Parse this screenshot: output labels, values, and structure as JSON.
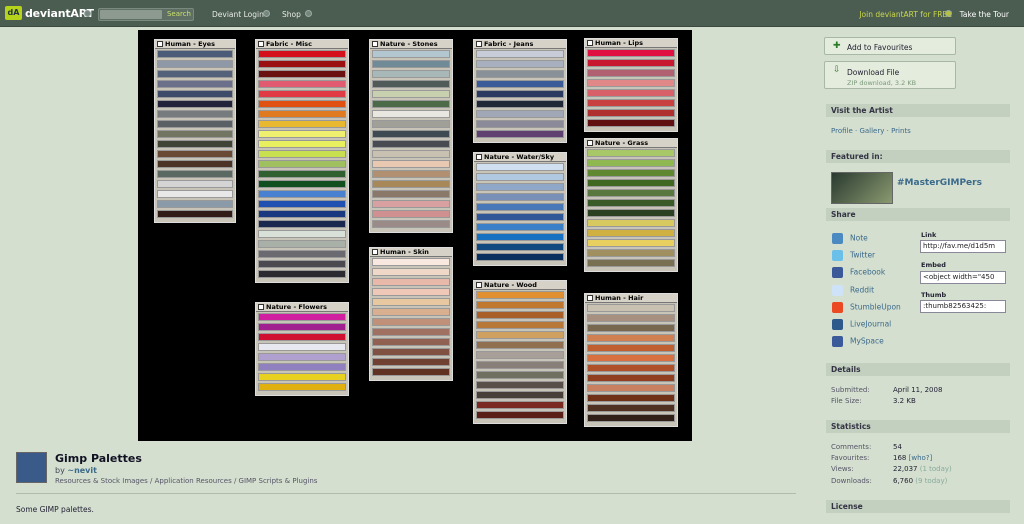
{
  "topbar": {
    "logo_text": "dA",
    "brand": "deviantART",
    "search_button": "Search",
    "login_label": "Deviant Login",
    "shop_label": "Shop",
    "join_label": "Join deviantART for FREE",
    "tour_label": "Take the Tour"
  },
  "palettes": [
    {
      "title": "Human - Eyes",
      "colors": [
        "#4b5b78",
        "#8e98a6",
        "#53617a",
        "#6b6f8a",
        "#3d4a6a",
        "#22233a",
        "#767b7e",
        "#5a6064",
        "#737563",
        "#3f4436",
        "#6a4a35",
        "#4b3325",
        "#5a6a62",
        "#d4d4d4",
        "#e8e8e8",
        "#8a9aa8",
        "#321c17"
      ]
    },
    {
      "title": "Fabric - Misc",
      "colors": [
        "#d3101c",
        "#9b1010",
        "#6a1010",
        "#e05a70",
        "#e03a45",
        "#e05010",
        "#e07a20",
        "#e8b830",
        "#f0f070",
        "#e8f060",
        "#c8e050",
        "#a0c060",
        "#306030",
        "#105020",
        "#4a80d0",
        "#2050b0",
        "#1a3880",
        "#1a2850",
        "#d8e0d8",
        "#a8b0a8",
        "#6a6a70",
        "#4a4a50",
        "#2a2a30"
      ]
    },
    {
      "title": "Nature - Stones",
      "colors": [
        "#b3c7d0",
        "#708a98",
        "#a8b8b8",
        "#505a58",
        "#c8d0b0",
        "#4a6a48",
        "#e8e8e0",
        "#a0a098",
        "#3e4a52",
        "#484c52",
        "#c8c0b0",
        "#e8c8b0",
        "#b09070",
        "#a88858",
        "#8a7868",
        "#d8a0a0",
        "#d09090",
        "#9a8a88"
      ]
    },
    {
      "title": "Fabric - Jeans",
      "colors": [
        "#c8ccd8",
        "#a8b0c0",
        "#889098",
        "#3a5a98",
        "#2a3a60",
        "#202838",
        "#a0a8b8",
        "#8a8a98",
        "#604070"
      ]
    },
    {
      "title": "Human - Lips",
      "colors": [
        "#e01040",
        "#c81830",
        "#b06070",
        "#e08888",
        "#d86068",
        "#c84040",
        "#b03030",
        "#601010"
      ]
    },
    {
      "title": "Nature - Water/Sky",
      "colors": [
        "#d0e0f0",
        "#b0c8e0",
        "#90a8c8",
        "#7890b8",
        "#4878b8",
        "#305898",
        "#3a80c8",
        "#1870c0",
        "#104880",
        "#0a3060"
      ]
    },
    {
      "title": "Nature - Grass",
      "colors": [
        "#a8c868",
        "#90b850",
        "#608830",
        "#406820",
        "#587840",
        "#3a5a28",
        "#2a4020",
        "#d8c860",
        "#d0b040",
        "#e8d060",
        "#a09060",
        "#787050"
      ]
    },
    {
      "title": "Nature - Flowers",
      "colors": [
        "#d020a0",
        "#a02090",
        "#d01030",
        "#e8e8f0",
        "#b0a0d0",
        "#9080c0",
        "#e8d020",
        "#e0b010"
      ]
    },
    {
      "title": "Human - Skin",
      "colors": [
        "#f8e8e0",
        "#f0d8c8",
        "#e8b8a8",
        "#f0c8b8",
        "#e8c8a0",
        "#d8b090",
        "#c09078",
        "#a07060",
        "#906050",
        "#805040",
        "#704030",
        "#603020"
      ]
    },
    {
      "title": "Nature - Wood",
      "colors": [
        "#e09030",
        "#c07830",
        "#a86028",
        "#b87838",
        "#d0a060",
        "#907050",
        "#a8a098",
        "#888078",
        "#707060",
        "#585048",
        "#484038",
        "#7a2a20",
        "#5a2018"
      ]
    },
    {
      "title": "Human - Hair",
      "colors": [
        "#c8c0b0",
        "#a89080",
        "#786850",
        "#d08050",
        "#c06030",
        "#d87040",
        "#b05028",
        "#904020",
        "#c88060",
        "#703018",
        "#503020",
        "#302018"
      ]
    }
  ],
  "sidebar": {
    "add_favourites": "Add to Favourites",
    "download_label": "Download File",
    "download_sub": "ZIP download, 3.2 KB",
    "visit_artist": "Visit the Artist",
    "artist_links": [
      "Profile",
      "Gallery",
      "Prints"
    ],
    "featured_in": "Featured in:",
    "group_name": "#MasterGIMPers",
    "share": "Share",
    "share_items": [
      "Note",
      "Twitter",
      "Facebook",
      "Reddit",
      "StumbleUpon",
      "LiveJournal",
      "MySpace"
    ],
    "share_colors": [
      "#4a8ac0",
      "#6ac0e8",
      "#3b5998",
      "#cee3f8",
      "#eb4924",
      "#2d5a8a",
      "#3a5a9a"
    ],
    "link_label": "Link",
    "link_value": "http://fav.me/d1d5m",
    "embed_label": "Embed",
    "embed_value": "<object width=\"450",
    "thumb_label": "Thumb",
    "thumb_value": ":thumb82563425:",
    "details": "Details",
    "submitted_label": "Submitted:",
    "submitted_value": "April 11, 2008",
    "filesize_label": "File Size:",
    "filesize_value": "3.2 KB",
    "statistics": "Statistics",
    "comments_label": "Comments:",
    "comments_value": "54",
    "favourites_label": "Favourites:",
    "favourites_value": "168",
    "favourites_who": "[who?]",
    "views_label": "Views:",
    "views_value": "22,037",
    "views_today": "(1 today)",
    "downloads_label": "Downloads:",
    "downloads_value": "6,760",
    "downloads_today": "(9 today)",
    "license": "License"
  },
  "deviation": {
    "title": "Gimp Palettes",
    "by": "by",
    "author": "~nevit",
    "breadcrumb": "Resources & Stock Images / Application Resources / GIMP Scripts & Plugins",
    "description": "Some GIMP palettes."
  }
}
